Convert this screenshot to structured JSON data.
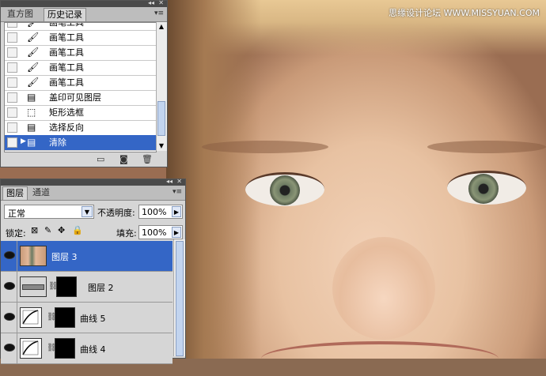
{
  "watermark": "思缘设计论坛 WWW.MISSYUAN.COM",
  "history_panel": {
    "tabs": [
      "直方图",
      "历史记录"
    ],
    "items": [
      {
        "label": "画笔工具",
        "icon": "brush-icon",
        "selected": false
      },
      {
        "label": "画笔工具",
        "icon": "brush-icon",
        "selected": false
      },
      {
        "label": "画笔工具",
        "icon": "brush-icon",
        "selected": false
      },
      {
        "label": "画笔工具",
        "icon": "brush-icon",
        "selected": false
      },
      {
        "label": "画笔工具",
        "icon": "brush-icon",
        "selected": false
      },
      {
        "label": "盖印可见图层",
        "icon": "document-icon",
        "selected": false
      },
      {
        "label": "矩形选框",
        "icon": "marquee-icon",
        "selected": false
      },
      {
        "label": "选择反向",
        "icon": "document-icon",
        "selected": false
      },
      {
        "label": "清除",
        "icon": "document-icon",
        "selected": true
      }
    ]
  },
  "layers_panel": {
    "tabs": [
      "图层",
      "通道"
    ],
    "blend_mode": "正常",
    "opacity_label": "不透明度:",
    "opacity_value": "100%",
    "lock_label": "锁定:",
    "fill_label": "填充:",
    "fill_value": "100%",
    "layers": [
      {
        "name": "图层 3",
        "selected": true,
        "type": "photo"
      },
      {
        "name": "图层 2",
        "selected": false,
        "type": "mask"
      },
      {
        "name": "曲线 5",
        "selected": false,
        "type": "curves"
      },
      {
        "name": "曲线 4",
        "selected": false,
        "type": "curves"
      }
    ]
  },
  "colors": {
    "selection": "#3466c6",
    "panel": "#d6d6d6"
  }
}
